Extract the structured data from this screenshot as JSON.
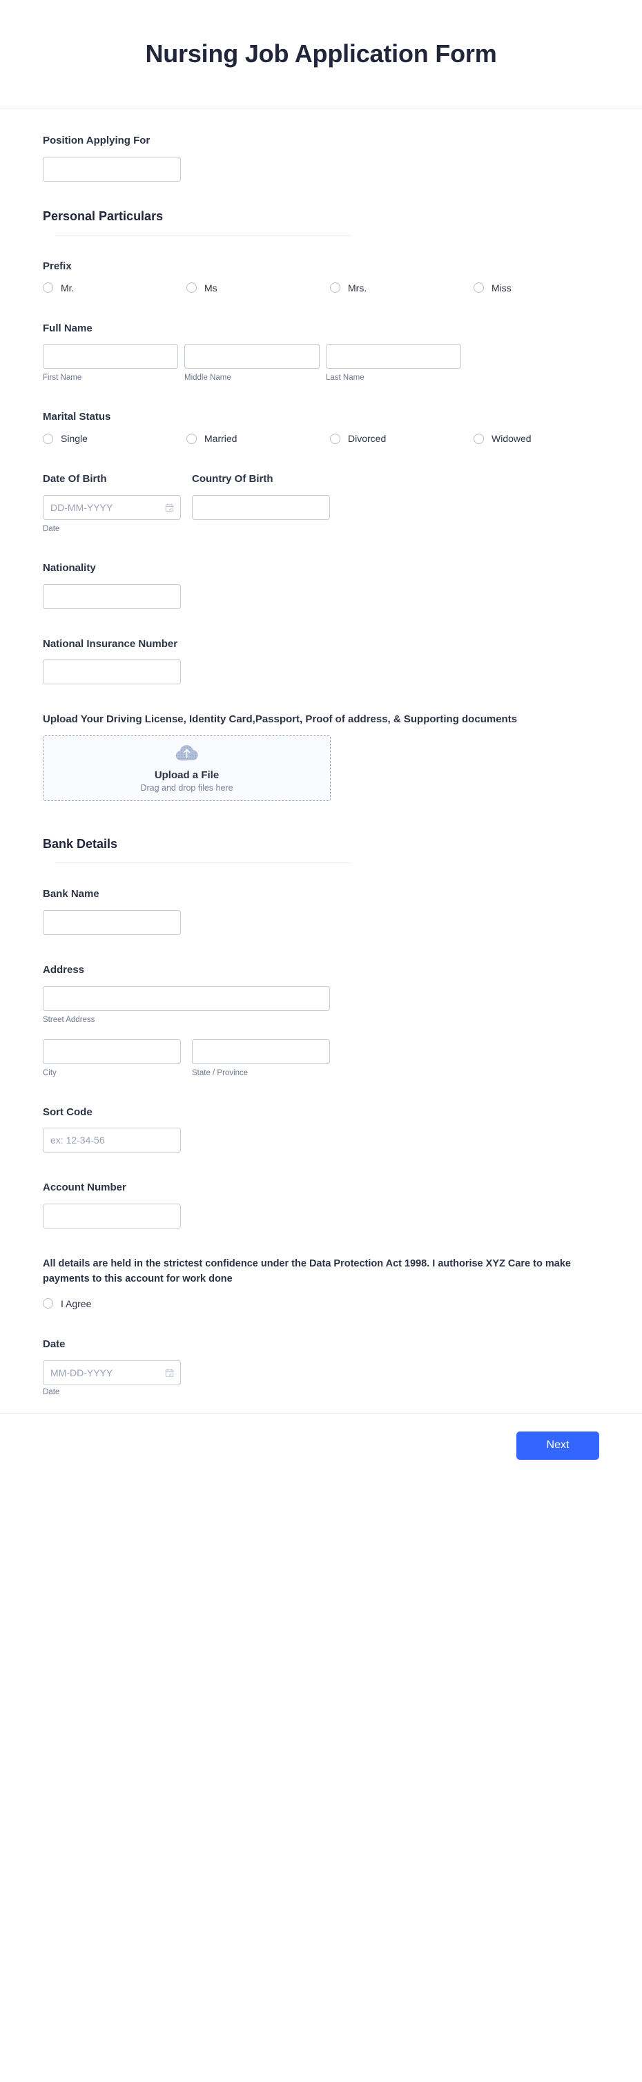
{
  "header": {
    "title": "Nursing Job Application Form"
  },
  "position": {
    "label": "Position Applying For",
    "value": "",
    "placeholder": ""
  },
  "sections": {
    "personal": {
      "title": "Personal Particulars"
    },
    "bank": {
      "title": "Bank Details"
    }
  },
  "prefix": {
    "label": "Prefix",
    "options": [
      {
        "label": "Mr."
      },
      {
        "label": "Ms"
      },
      {
        "label": "Mrs."
      },
      {
        "label": "Miss"
      }
    ]
  },
  "full_name": {
    "label": "Full Name",
    "fields": [
      {
        "sub_label": "First Name",
        "value": "",
        "placeholder": ""
      },
      {
        "sub_label": "Middle Name",
        "value": "",
        "placeholder": ""
      },
      {
        "sub_label": "Last Name",
        "value": "",
        "placeholder": ""
      }
    ]
  },
  "marital_status": {
    "label": "Marital Status",
    "options": [
      {
        "label": "Single"
      },
      {
        "label": "Married"
      },
      {
        "label": "Divorced"
      },
      {
        "label": "Widowed"
      }
    ]
  },
  "date_of_birth": {
    "label": "Date Of Birth",
    "placeholder": "DD-MM-YYYY",
    "value": "",
    "sub_label": "Date"
  },
  "country_of_birth": {
    "label": "Country Of Birth",
    "value": "",
    "placeholder": ""
  },
  "nationality": {
    "label": "Nationality",
    "value": "",
    "placeholder": ""
  },
  "national_insurance_number": {
    "label": "National Insurance Number",
    "value": "",
    "placeholder": ""
  },
  "upload": {
    "label": "Upload Your Driving License, Identity Card,Passport, Proof of address, & Supporting documents",
    "title": "Upload a File",
    "subtitle": "Drag and drop files here",
    "icon": "cloud-upload-icon"
  },
  "bank_name": {
    "label": "Bank Name",
    "value": "",
    "placeholder": ""
  },
  "address": {
    "label": "Address",
    "street": {
      "sub_label": "Street Address",
      "value": "",
      "placeholder": ""
    },
    "city": {
      "sub_label": "City",
      "value": "",
      "placeholder": ""
    },
    "state": {
      "sub_label": "State / Province",
      "value": "",
      "placeholder": ""
    }
  },
  "sort_code": {
    "label": "Sort Code",
    "placeholder": "ex: 12-34-56",
    "value": ""
  },
  "account_number": {
    "label": "Account Number",
    "value": "",
    "placeholder": ""
  },
  "declaration": {
    "text": "All details are held in the strictest confidence under the Data Protection Act 1998. I authorise XYZ Care to make payments to this account for work done",
    "agree_label": "I Agree"
  },
  "signature_date": {
    "label": "Date",
    "placeholder": "MM-DD-YYYY",
    "value": "",
    "sub_label": "Date"
  },
  "footer": {
    "next_label": "Next"
  },
  "colors": {
    "accent": "#3366ff",
    "text": "#2c3345",
    "sub_text": "#6f7792",
    "border": "#c3cad9",
    "rule": "#e8eaf0",
    "upload_bg": "#fafbfe"
  }
}
